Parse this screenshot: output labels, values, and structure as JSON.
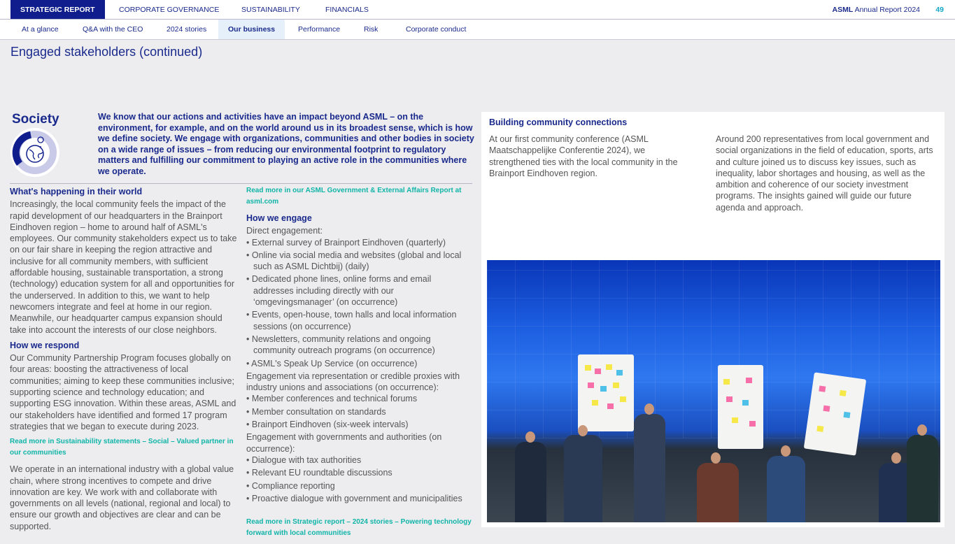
{
  "topnav": {
    "tabs": [
      "STRATEGIC REPORT",
      "CORPORATE GOVERNANCE",
      "SUSTAINABILITY",
      "FINANCIALS"
    ],
    "brand_bold": "ASML",
    "brand_rest": "Annual Report 2024",
    "page": "49"
  },
  "subnav": [
    "At a glance",
    "Q&A with the CEO",
    "2024 stories",
    "Our business",
    "Performance",
    "Risk",
    "Corporate conduct"
  ],
  "page_title": "Engaged stakeholders (continued)",
  "society": {
    "title": "Society",
    "intro": "We know that our actions and activities have an impact beyond ASML – on the environment, for example, and on the world around us in its broadest sense, which is how we define society. We engage with organizations, communities and other bodies in society on a wide range of issues – from reducing our environmental footprint to regulatory matters and fulfilling our commitment to playing an active role in the communities where we operate."
  },
  "left": {
    "h1": "What's happening in their world",
    "p1": "Increasingly, the local community feels the impact of the rapid development of our headquarters in the Brainport Eindhoven region – home to around half of ASML's employees. Our community stakeholders expect us to take on our fair share in keeping the region attractive and inclusive for all community members, with sufficient affordable housing, sustainable transportation, a strong (technology) education system for all and opportunities for the underserved. In addition to this, we want to help newcomers integrate and feel at home in our region. Meanwhile, our headquarter campus expansion should take into account the interests of our close neighbors.",
    "h2": "How we respond",
    "p2": "Our Community Partnership Program focuses globally on four areas: boosting the attractiveness of local communities; aiming to keep these communities inclusive; supporting science and technology education; and supporting ESG innovation. Within these areas, ASML and our stakeholders have identified and formed 17 program strategies that we began to execute during 2023.",
    "link": "Read more in Sustainability statements – Social – Valued partner in our communities",
    "p3": "We operate in an international industry with a global value chain, where strong incentives to compete and drive innovation are key. We work with and collaborate with governments on all levels (national, regional and local) to ensure our growth and objectives are clear and can be supported."
  },
  "middle": {
    "link1": "Read more in our ASML Government & External Affairs Report at asml.com",
    "h": "How we engage",
    "g1": "Direct engagement:",
    "l1": [
      "External survey of Brainport Eindhoven (quarterly)",
      "Online via social media and websites (global and local such as ASML Dichtbij) (daily)",
      "Dedicated phone lines, online forms and email addresses including directly with our ‘omgevingsmanager’ (on occurrence)",
      "Events, open-house, town halls and local information sessions (on occurrence)",
      "Newsletters, community relations and ongoing community outreach programs (on occurrence)",
      "ASML's Speak Up Service (on occurrence)"
    ],
    "g2": "Engagement via representation or credible proxies with industry unions and associations (on occurrence):",
    "l2": [
      "Member conferences and technical forums",
      "Member consultation on standards",
      "Brainport Eindhoven (six-week intervals)"
    ],
    "g3": "Engagement with governments and authorities (on occurrence):",
    "l3": [
      "Dialogue with tax authorities",
      "Relevant EU roundtable discussions",
      "Compliance reporting",
      "Proactive dialogue with government and municipalities"
    ],
    "link2": "Read more in Strategic report – 2024 stories – Powering technology forward with local communities"
  },
  "panel": {
    "title": "Building community connections",
    "p1": "At our first community conference (ASML Maatschappelijke Conferentie 2024), we strengthened ties with the local community in the Brainport Eindhoven region.",
    "p2": "Around 200 representatives from local government and social organizations in the field of education, sports, arts and culture joined us to discuss key issues, such as inequality, labor shortages and housing, as well as the ambition and coherence of our society investment programs. The insights gained will guide our future agenda and approach."
  },
  "colors": {
    "navy": "#0f1e8c",
    "teal": "#10b5a8"
  }
}
